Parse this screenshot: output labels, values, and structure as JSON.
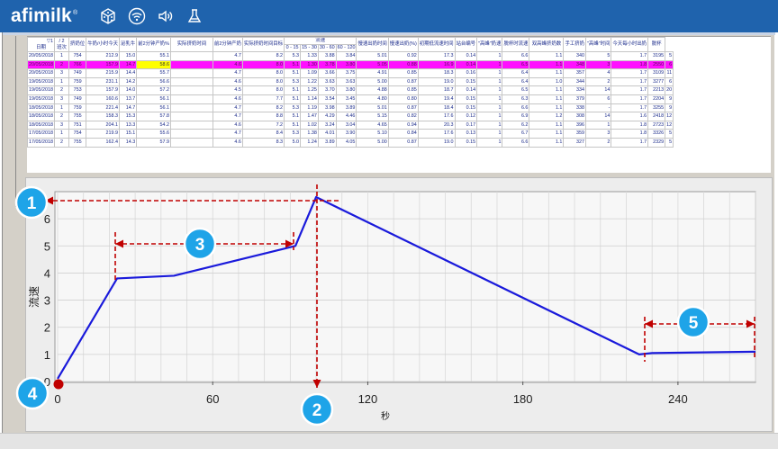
{
  "header": {
    "logo_text": "afimilk",
    "logo_mark": "®",
    "icons": [
      "dice-icon",
      "wifi-icon",
      "speaker-icon",
      "flask-icon"
    ]
  },
  "table": {
    "head_row1": [
      "日期",
      "班次",
      "挤奶位",
      "牛奶/小时今天",
      "泌乳牛",
      "前2分钟产奶%",
      "实际挤奶时间",
      "前2分钟产奶",
      "实际挤奶时间目标",
      "流速",
      "慢速出奶时间",
      "慢速出奶(%)",
      "初期低流速时间",
      "站台编号",
      "\"高峰\"奶速",
      "脱杯时流速",
      "双高峰挤奶数",
      "手工挤奶",
      "\"高峰\"时间",
      "今天每小时出奶",
      "脱杯"
    ],
    "flow_bins": [
      "0 - 15",
      "15 - 30",
      "30 - 60",
      "60 - 120"
    ],
    "sort_marks": [
      "▽1",
      "/ 2"
    ],
    "rows": [
      [
        "20/05/2018",
        "1",
        "754",
        "212.9",
        "15.0",
        "55.1",
        "",
        "4.7",
        "8.2",
        "5.3",
        "1.33",
        "3.88",
        "3.84",
        "5.01",
        "0.92",
        "17.3",
        "0.14",
        "1",
        "6.6",
        "1.1",
        "340",
        "5",
        "1.7",
        "3195",
        "5"
      ],
      [
        "20/05/2018",
        "2",
        "766",
        "157.9",
        "14.7",
        "58.6",
        "",
        "4.6",
        "8.0",
        "5.1",
        "1.30",
        "3.78",
        "3.80",
        "5.05",
        "0.88",
        "16.9",
        "0.14",
        "1",
        "6.5",
        "1.1",
        "348",
        "3",
        "1.8",
        "2550",
        "6"
      ],
      [
        "20/05/2018",
        "3",
        "749",
        "215.9",
        "14.4",
        "55.7",
        "",
        "4.7",
        "8.0",
        "5.1",
        "1.09",
        "3.66",
        "3.75",
        "4.91",
        "0.85",
        "18.3",
        "0.16",
        "1",
        "6.4",
        "1.1",
        "357",
        "4",
        "1.7",
        "3109",
        "11"
      ],
      [
        "19/05/2018",
        "1",
        "759",
        "231.1",
        "14.2",
        "56.6",
        "",
        "4.6",
        "8.0",
        "5.3",
        "1.22",
        "3.63",
        "3.63",
        "5.00",
        "0.87",
        "19.0",
        "0.15",
        "1",
        "6.4",
        "1.0",
        "344",
        "2",
        "1.7",
        "3277",
        "6"
      ],
      [
        "19/05/2018",
        "2",
        "753",
        "157.9",
        "14.0",
        "57.2",
        "",
        "4.5",
        "8.0",
        "5.1",
        "1.25",
        "3.70",
        "3.80",
        "4.88",
        "0.85",
        "18.7",
        "0.14",
        "1",
        "6.5",
        "1.1",
        "334",
        "14",
        "1.7",
        "2213",
        "20"
      ],
      [
        "19/05/2018",
        "3",
        "749",
        "160.6",
        "13.7",
        "56.1",
        "",
        "4.6",
        "7.7",
        "5.1",
        "1.14",
        "3.54",
        "3.45",
        "4.80",
        "0.80",
        "19.4",
        "0.15",
        "1",
        "6.3",
        "1.1",
        "379",
        "6",
        "1.7",
        "2204",
        "9"
      ],
      [
        "18/05/2018",
        "1",
        "759",
        "221.4",
        "14.7",
        "56.1",
        "",
        "4.7",
        "8.2",
        "5.3",
        "1.19",
        "3.98",
        "3.89",
        "5.01",
        "0.87",
        "18.4",
        "0.15",
        "1",
        "6.6",
        "1.1",
        "338",
        "-",
        "1.7",
        "3255",
        "9"
      ],
      [
        "18/05/2018",
        "2",
        "755",
        "158.3",
        "15.3",
        "57.8",
        "",
        "4.7",
        "8.8",
        "5.1",
        "1.47",
        "4.29",
        "4.46",
        "5.15",
        "0.82",
        "17.6",
        "0.12",
        "1",
        "6.9",
        "1.2",
        "308",
        "14",
        "1.6",
        "2418",
        "12"
      ],
      [
        "18/05/2018",
        "3",
        "751",
        "204.1",
        "13.3",
        "54.2",
        "",
        "4.6",
        "7.2",
        "5.1",
        "1.02",
        "3.24",
        "3.04",
        "4.65",
        "0.94",
        "20.3",
        "0.17",
        "1",
        "6.2",
        "1.1",
        "396",
        "1",
        "1.8",
        "2723",
        "12"
      ],
      [
        "17/05/2018",
        "1",
        "754",
        "219.9",
        "15.1",
        "55.6",
        "",
        "4.7",
        "8.4",
        "5.3",
        "1.38",
        "4.01",
        "3.90",
        "5.10",
        "0.84",
        "17.6",
        "0.13",
        "1",
        "6.7",
        "1.1",
        "359",
        "3",
        "1.8",
        "3326",
        "5"
      ],
      [
        "17/05/2018",
        "2",
        "755",
        "162.4",
        "14.3",
        "57.9",
        "",
        "4.6",
        "8.3",
        "5.0",
        "1.24",
        "3.89",
        "4.05",
        "5.00",
        "0.87",
        "19.0",
        "0.15",
        "1",
        "6.6",
        "1.1",
        "327",
        "2",
        "1.7",
        "2329",
        "5"
      ]
    ],
    "highlight_row": 1,
    "highlight_cell": 5
  },
  "chart_data": {
    "type": "line",
    "xlabel": "秒",
    "ylabel": "流速",
    "x_ticks": [
      0,
      60,
      120,
      180,
      240
    ],
    "y_ticks": [
      0,
      1,
      2,
      3,
      4,
      5,
      6
    ],
    "xlim": [
      0,
      270
    ],
    "ylim": [
      0,
      7
    ],
    "grid": true,
    "series": [
      {
        "color": "#1a1adb",
        "x": [
          0,
          23,
          45,
          92,
          100,
          225,
          230,
          270
        ],
        "y": [
          0.1,
          3.8,
          3.9,
          5.0,
          6.8,
          1.0,
          1.05,
          1.1
        ]
      }
    ]
  },
  "annotations": {
    "badges": [
      "1",
      "2",
      "3",
      "4",
      "5"
    ],
    "arrow_color": "#c00000",
    "badge_color": "#1ea4e8",
    "origin_marker_color": "#c00000"
  }
}
